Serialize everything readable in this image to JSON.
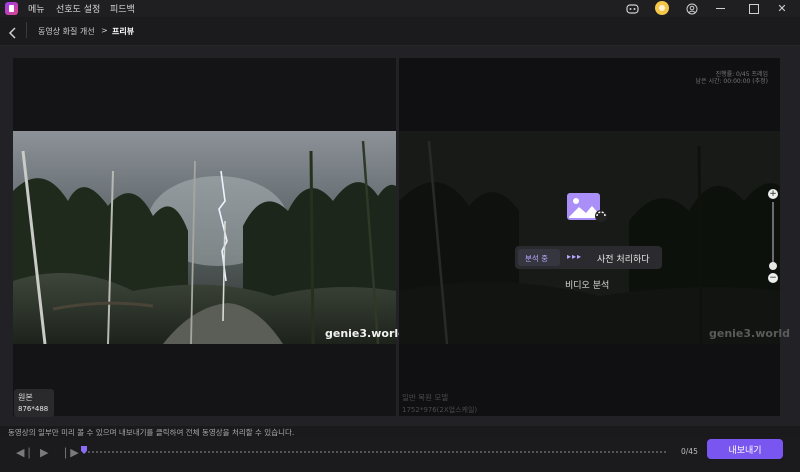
{
  "menu": {
    "items": [
      "메뉴",
      "선호도 설정",
      "피드백"
    ]
  },
  "breadcrumb": {
    "parent": "동영상 화질 개선",
    "separator": ">",
    "current": "프리뷰"
  },
  "left_panel": {
    "watermark": "genie3.world",
    "label": "원본",
    "resolution": "876*488"
  },
  "right_panel": {
    "watermark": "genie3.world",
    "info_line1": "진행률: 0/45 프레임",
    "info_line2": "남은 시간: 00:00:00 (추정)",
    "status_badge": "분석 중",
    "stage_text": "사전 처리하다",
    "sub_status": "비디오 분석",
    "model_label": "일반 복원 모델",
    "model_resolution": "1752*976(2X업스케일)"
  },
  "hint": "동영상의 일부만 미리 볼 수 있으며 내보내기를 클릭하여 전체 동영상을 처리할 수 있습니다.",
  "timeline": {
    "frame_counter": "0/45",
    "progress": 0
  },
  "export_button": "내보내기",
  "zoom": {
    "plus": "+",
    "minus": "−",
    "level": 0.62
  },
  "colors": {
    "accent": "#7a56f0",
    "background": "#1a1a1c"
  },
  "icons": [
    "app-logo-icon",
    "discord-icon",
    "user-avatar",
    "account-icon",
    "minimize-icon",
    "maximize-icon",
    "close-icon",
    "back-arrow-icon",
    "image-processing-icon",
    "play-icon",
    "prev-frame-icon",
    "next-frame-icon"
  ]
}
